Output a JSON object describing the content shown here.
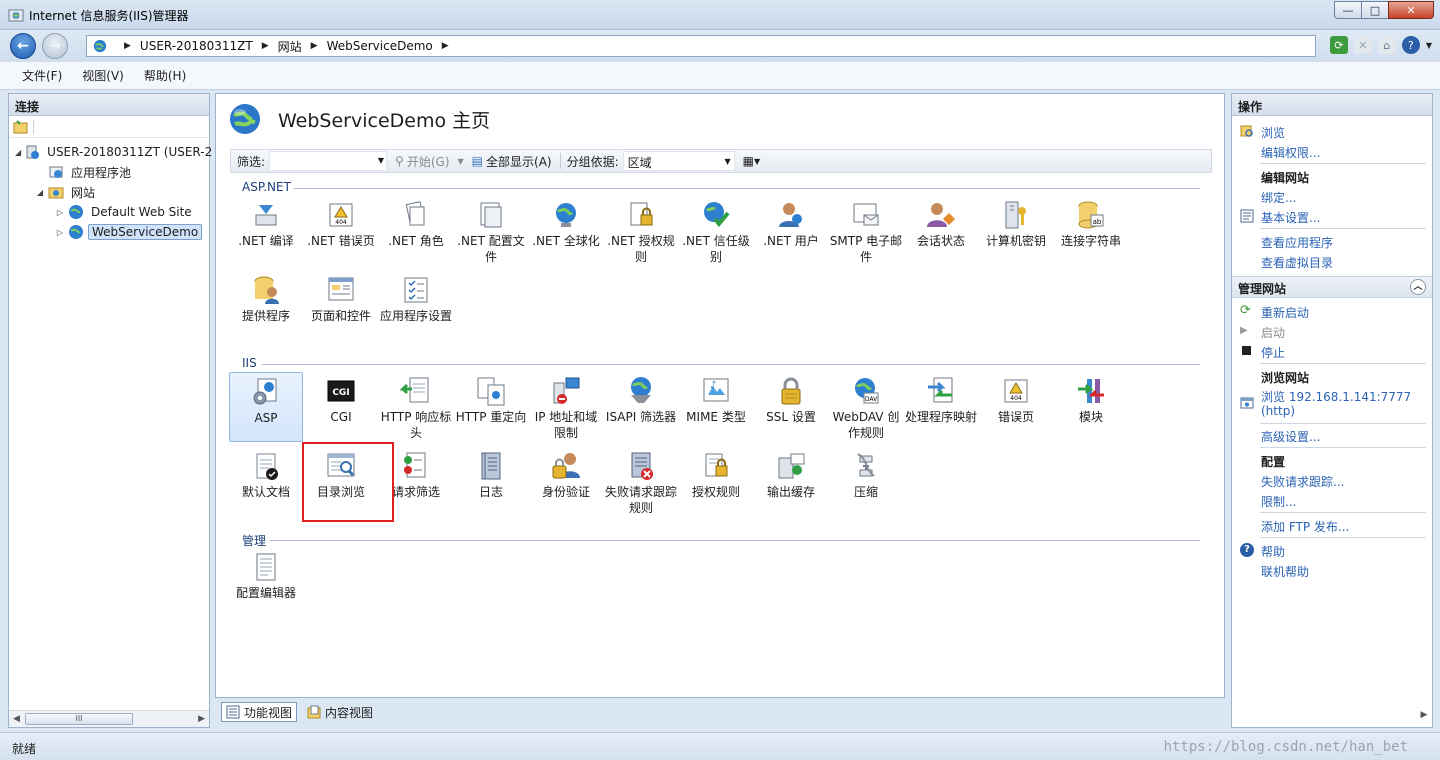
{
  "window": {
    "title": "Internet 信息服务(IIS)管理器",
    "controls": {
      "minimize": "—",
      "maximize": "□",
      "close": "✕"
    }
  },
  "address_bar": {
    "crumbs": [
      "USER-20180311ZT",
      "网站",
      "WebServiceDemo"
    ],
    "separator": "▶"
  },
  "menu": [
    "文件(F)",
    "视图(V)",
    "帮助(H)"
  ],
  "connections": {
    "title": "连接",
    "tree": [
      {
        "label": "USER-20180311ZT (USER-2",
        "level": 0,
        "toggle": "◢",
        "icon": "server-icon"
      },
      {
        "label": "应用程序池",
        "level": 1,
        "toggle": "",
        "icon": "app-pool-icon"
      },
      {
        "label": "网站",
        "level": 1,
        "toggle": "◢",
        "icon": "sites-folder-icon"
      },
      {
        "label": "Default Web Site",
        "level": 2,
        "toggle": "▷",
        "icon": "globe-icon"
      },
      {
        "label": "WebServiceDemo",
        "level": 2,
        "toggle": "▷",
        "icon": "globe-icon",
        "selected": true
      }
    ],
    "scroll_label": "III"
  },
  "main": {
    "title": "WebServiceDemo 主页",
    "filter": {
      "label": "筛选:",
      "value": "",
      "go_label": "开始(G)",
      "show_all_label": "全部显示(A)",
      "group_label": "分组依据:",
      "group_value": "区域"
    },
    "sections": [
      {
        "title": "ASP.NET",
        "items": [
          {
            "label": ".NET 编译",
            "icon": "net-compile-icon"
          },
          {
            "label": ".NET 错误页",
            "icon": "net-error-page-icon"
          },
          {
            "label": ".NET 角色",
            "icon": "net-roles-icon"
          },
          {
            "label": ".NET 配置文件",
            "icon": "net-profile-icon"
          },
          {
            "label": ".NET 全球化",
            "icon": "net-globalization-icon"
          },
          {
            "label": ".NET 授权规则",
            "icon": "net-authorization-icon"
          },
          {
            "label": ".NET 信任级别",
            "icon": "net-trust-level-icon"
          },
          {
            "label": ".NET 用户",
            "icon": "net-users-icon"
          },
          {
            "label": "SMTP 电子邮件",
            "icon": "smtp-email-icon"
          },
          {
            "label": "会话状态",
            "icon": "session-state-icon"
          },
          {
            "label": "计算机密钥",
            "icon": "machine-key-icon"
          },
          {
            "label": "连接字符串",
            "icon": "connection-strings-icon"
          },
          {
            "label": "提供程序",
            "icon": "providers-icon"
          },
          {
            "label": "页面和控件",
            "icon": "pages-controls-icon"
          },
          {
            "label": "应用程序设置",
            "icon": "app-settings-icon"
          }
        ]
      },
      {
        "title": "IIS",
        "items": [
          {
            "label": "ASP",
            "icon": "asp-icon",
            "selected": true
          },
          {
            "label": "CGI",
            "icon": "cgi-icon"
          },
          {
            "label": "HTTP 响应标头",
            "icon": "http-response-headers-icon"
          },
          {
            "label": "HTTP 重定向",
            "icon": "http-redirect-icon"
          },
          {
            "label": "IP 地址和域限制",
            "icon": "ip-domain-restrictions-icon"
          },
          {
            "label": "ISAPI 筛选器",
            "icon": "isapi-filters-icon"
          },
          {
            "label": "MIME 类型",
            "icon": "mime-types-icon"
          },
          {
            "label": "SSL 设置",
            "icon": "ssl-settings-icon"
          },
          {
            "label": "WebDAV 创作规则",
            "icon": "webdav-icon"
          },
          {
            "label": "处理程序映射",
            "icon": "handler-mappings-icon"
          },
          {
            "label": "错误页",
            "icon": "error-pages-icon"
          },
          {
            "label": "模块",
            "icon": "modules-icon"
          },
          {
            "label": "默认文档",
            "icon": "default-document-icon"
          },
          {
            "label": "目录浏览",
            "icon": "directory-browsing-icon",
            "highlighted": true
          },
          {
            "label": "请求筛选",
            "icon": "request-filtering-icon"
          },
          {
            "label": "日志",
            "icon": "logging-icon"
          },
          {
            "label": "身份验证",
            "icon": "authentication-icon"
          },
          {
            "label": "失败请求跟踪规则",
            "icon": "failed-request-tracing-icon"
          },
          {
            "label": "授权规则",
            "icon": "authorization-rules-icon"
          },
          {
            "label": "输出缓存",
            "icon": "output-caching-icon"
          },
          {
            "label": "压缩",
            "icon": "compression-icon"
          }
        ]
      },
      {
        "title": "管理",
        "items": [
          {
            "label": "配置编辑器",
            "icon": "config-editor-icon"
          }
        ]
      }
    ]
  },
  "view_tabs": [
    {
      "label": "功能视图",
      "icon": "features-view-icon",
      "active": true
    },
    {
      "label": "内容视图",
      "icon": "content-view-icon",
      "active": false
    }
  ],
  "actions": {
    "title": "操作",
    "browse": "浏览",
    "edit_permissions": "编辑权限...",
    "edit_site_head": "编辑网站",
    "bindings": "绑定...",
    "basic_settings": "基本设置...",
    "view_applications": "查看应用程序",
    "view_virtual_dirs": "查看虚拟目录",
    "manage_site_head": "管理网站",
    "restart": "重新启动",
    "start": "启动",
    "stop": "停止",
    "browse_site_head": "浏览网站",
    "browse_url": "浏览 192.168.1.141:7777",
    "browse_url_proto": "(http)",
    "advanced_settings": "高级设置...",
    "config_head": "配置",
    "failed_tracing": "失败请求跟踪...",
    "limits": "限制...",
    "add_ftp": "添加 FTP 发布...",
    "help": "帮助",
    "online_help": "联机帮助"
  },
  "status": {
    "text": "就绪",
    "watermark": "https://blog.csdn.net/han_bet"
  },
  "colors": {
    "link": "#2b63b5",
    "highlight_box": "#e02020",
    "section_title": "#1d3f78"
  }
}
